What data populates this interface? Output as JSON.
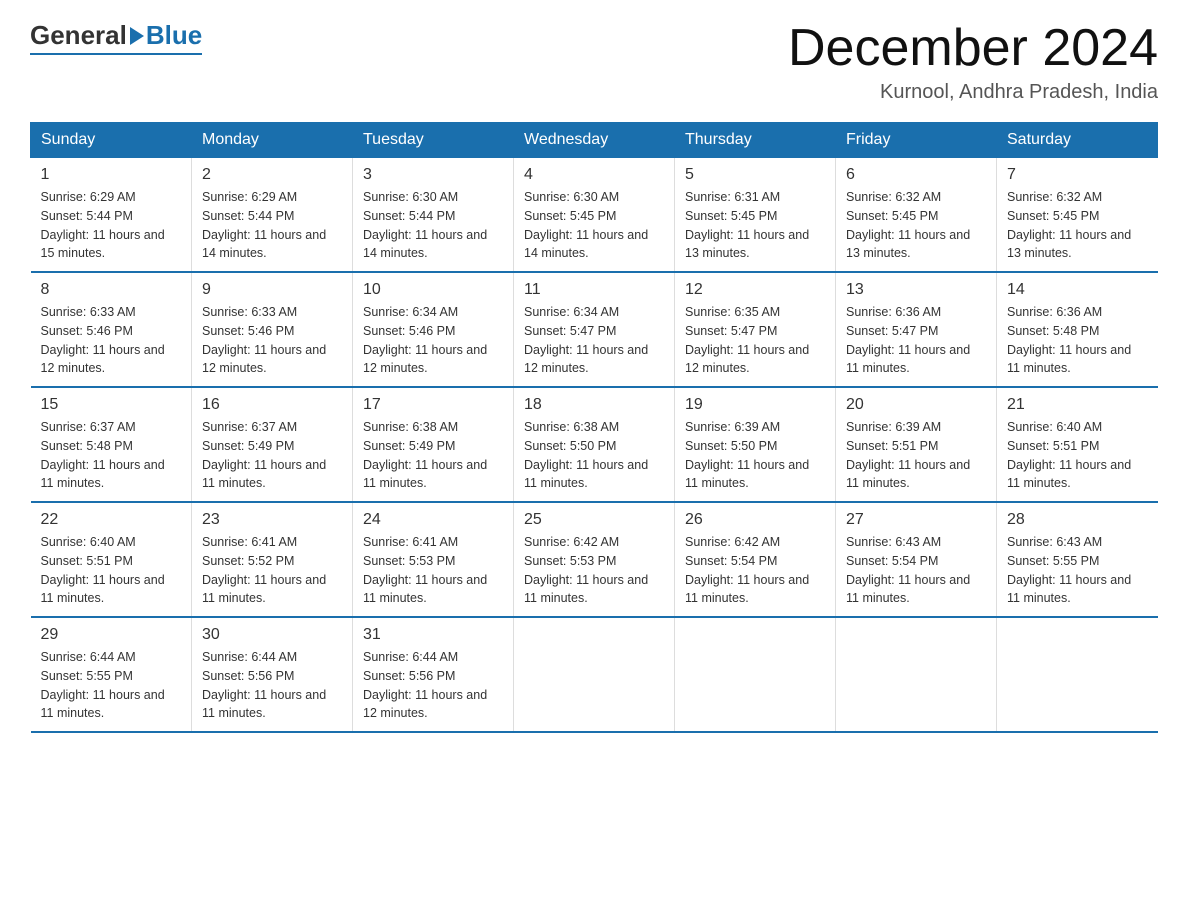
{
  "header": {
    "logo_general": "General",
    "logo_blue": "Blue",
    "month_title": "December 2024",
    "location": "Kurnool, Andhra Pradesh, India"
  },
  "days_of_week": [
    "Sunday",
    "Monday",
    "Tuesday",
    "Wednesday",
    "Thursday",
    "Friday",
    "Saturday"
  ],
  "weeks": [
    [
      {
        "day": "1",
        "sunrise": "6:29 AM",
        "sunset": "5:44 PM",
        "daylight": "11 hours and 15 minutes."
      },
      {
        "day": "2",
        "sunrise": "6:29 AM",
        "sunset": "5:44 PM",
        "daylight": "11 hours and 14 minutes."
      },
      {
        "day": "3",
        "sunrise": "6:30 AM",
        "sunset": "5:44 PM",
        "daylight": "11 hours and 14 minutes."
      },
      {
        "day": "4",
        "sunrise": "6:30 AM",
        "sunset": "5:45 PM",
        "daylight": "11 hours and 14 minutes."
      },
      {
        "day": "5",
        "sunrise": "6:31 AM",
        "sunset": "5:45 PM",
        "daylight": "11 hours and 13 minutes."
      },
      {
        "day": "6",
        "sunrise": "6:32 AM",
        "sunset": "5:45 PM",
        "daylight": "11 hours and 13 minutes."
      },
      {
        "day": "7",
        "sunrise": "6:32 AM",
        "sunset": "5:45 PM",
        "daylight": "11 hours and 13 minutes."
      }
    ],
    [
      {
        "day": "8",
        "sunrise": "6:33 AM",
        "sunset": "5:46 PM",
        "daylight": "11 hours and 12 minutes."
      },
      {
        "day": "9",
        "sunrise": "6:33 AM",
        "sunset": "5:46 PM",
        "daylight": "11 hours and 12 minutes."
      },
      {
        "day": "10",
        "sunrise": "6:34 AM",
        "sunset": "5:46 PM",
        "daylight": "11 hours and 12 minutes."
      },
      {
        "day": "11",
        "sunrise": "6:34 AM",
        "sunset": "5:47 PM",
        "daylight": "11 hours and 12 minutes."
      },
      {
        "day": "12",
        "sunrise": "6:35 AM",
        "sunset": "5:47 PM",
        "daylight": "11 hours and 12 minutes."
      },
      {
        "day": "13",
        "sunrise": "6:36 AM",
        "sunset": "5:47 PM",
        "daylight": "11 hours and 11 minutes."
      },
      {
        "day": "14",
        "sunrise": "6:36 AM",
        "sunset": "5:48 PM",
        "daylight": "11 hours and 11 minutes."
      }
    ],
    [
      {
        "day": "15",
        "sunrise": "6:37 AM",
        "sunset": "5:48 PM",
        "daylight": "11 hours and 11 minutes."
      },
      {
        "day": "16",
        "sunrise": "6:37 AM",
        "sunset": "5:49 PM",
        "daylight": "11 hours and 11 minutes."
      },
      {
        "day": "17",
        "sunrise": "6:38 AM",
        "sunset": "5:49 PM",
        "daylight": "11 hours and 11 minutes."
      },
      {
        "day": "18",
        "sunrise": "6:38 AM",
        "sunset": "5:50 PM",
        "daylight": "11 hours and 11 minutes."
      },
      {
        "day": "19",
        "sunrise": "6:39 AM",
        "sunset": "5:50 PM",
        "daylight": "11 hours and 11 minutes."
      },
      {
        "day": "20",
        "sunrise": "6:39 AM",
        "sunset": "5:51 PM",
        "daylight": "11 hours and 11 minutes."
      },
      {
        "day": "21",
        "sunrise": "6:40 AM",
        "sunset": "5:51 PM",
        "daylight": "11 hours and 11 minutes."
      }
    ],
    [
      {
        "day": "22",
        "sunrise": "6:40 AM",
        "sunset": "5:51 PM",
        "daylight": "11 hours and 11 minutes."
      },
      {
        "day": "23",
        "sunrise": "6:41 AM",
        "sunset": "5:52 PM",
        "daylight": "11 hours and 11 minutes."
      },
      {
        "day": "24",
        "sunrise": "6:41 AM",
        "sunset": "5:53 PM",
        "daylight": "11 hours and 11 minutes."
      },
      {
        "day": "25",
        "sunrise": "6:42 AM",
        "sunset": "5:53 PM",
        "daylight": "11 hours and 11 minutes."
      },
      {
        "day": "26",
        "sunrise": "6:42 AM",
        "sunset": "5:54 PM",
        "daylight": "11 hours and 11 minutes."
      },
      {
        "day": "27",
        "sunrise": "6:43 AM",
        "sunset": "5:54 PM",
        "daylight": "11 hours and 11 minutes."
      },
      {
        "day": "28",
        "sunrise": "6:43 AM",
        "sunset": "5:55 PM",
        "daylight": "11 hours and 11 minutes."
      }
    ],
    [
      {
        "day": "29",
        "sunrise": "6:44 AM",
        "sunset": "5:55 PM",
        "daylight": "11 hours and 11 minutes."
      },
      {
        "day": "30",
        "sunrise": "6:44 AM",
        "sunset": "5:56 PM",
        "daylight": "11 hours and 11 minutes."
      },
      {
        "day": "31",
        "sunrise": "6:44 AM",
        "sunset": "5:56 PM",
        "daylight": "11 hours and 12 minutes."
      },
      {
        "day": "",
        "sunrise": "",
        "sunset": "",
        "daylight": ""
      },
      {
        "day": "",
        "sunrise": "",
        "sunset": "",
        "daylight": ""
      },
      {
        "day": "",
        "sunrise": "",
        "sunset": "",
        "daylight": ""
      },
      {
        "day": "",
        "sunrise": "",
        "sunset": "",
        "daylight": ""
      }
    ]
  ],
  "labels": {
    "sunrise": "Sunrise:",
    "sunset": "Sunset:",
    "daylight": "Daylight:"
  }
}
